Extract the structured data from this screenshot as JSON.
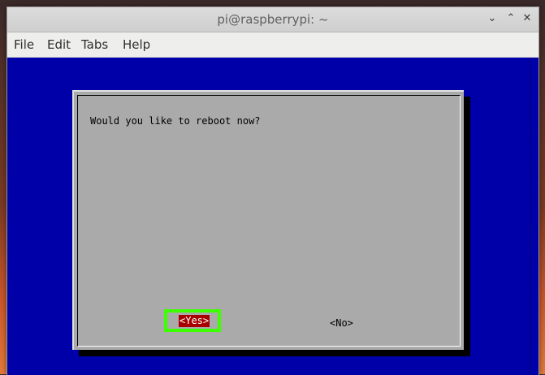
{
  "window": {
    "title": "pi@raspberrypi: ~",
    "controls": [
      "chevron-down-icon",
      "chevron-up-icon",
      "close-icon"
    ]
  },
  "menu": {
    "items": [
      {
        "label": "File"
      },
      {
        "label": "Edit"
      },
      {
        "label": "Tabs"
      },
      {
        "label": "Help"
      }
    ]
  },
  "dialog": {
    "prompt": "Would you like to reboot now?",
    "yes_label": "<Yes>",
    "no_label": "<No>",
    "selected": "yes"
  },
  "colors": {
    "terminal_bg": "#0000a8",
    "dialog_bg": "#aaaaaa",
    "selected_button_bg": "#a80000",
    "highlight_outline": "#3cff00"
  }
}
